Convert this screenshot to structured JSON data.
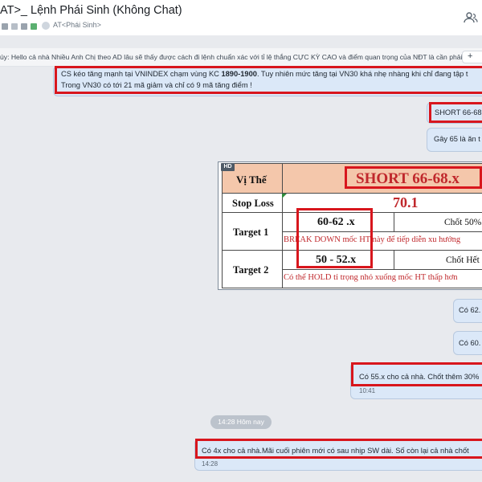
{
  "header": {
    "title": "AT>_ Lệnh Phái Sinh (Không Chat)",
    "subtitle": "AT<Phái Sinh>",
    "members_icon": "people-icon"
  },
  "pinned": {
    "text": "úy: Hello cả nhà Nhiều Anh Chị theo AD lâu sẽ thấy được cách đi lệnh chuẩn xác với tỉ lệ thắng CỰC KỲ CAO và điểm quan trọng của NĐT là cần phải ...",
    "button_label": "+"
  },
  "messages": {
    "m1": {
      "line1_pre": "CS kéo tăng mạnh tại VNINDEX chạm vùng KC ",
      "line1_bold": "1890-1900",
      "line1_post": ". Tuy nhiên mức tăng tại VN30 khá nhẹ nhàng khi chỉ đang tập t",
      "line2": "Trong VN30 có tới 21 mã giảm và chỉ có 9 mã tăng điểm !"
    },
    "m2": {
      "text": "SHORT 66-68."
    },
    "m3": {
      "text": "Gây 65 là ăn t"
    },
    "m5": {
      "text": "Có 62."
    },
    "m6": {
      "text": "Có 60."
    },
    "m7": {
      "text": "Có 55.x cho cả nhà. Chốt thêm 30%",
      "time": "10:41"
    },
    "divider": "14:28 Hôm nay",
    "m8": {
      "text": "Có 4x cho cả nhà.Mãi cuối phiên mới có sau nhịp SW dài. Số còn lại cả nhà chốt",
      "time": "14:28"
    }
  },
  "signal_image": {
    "badge": "HD",
    "vi_the_label": "Vị Thế",
    "position": "SHORT 66-68.x",
    "stop_loss_label": "Stop Loss",
    "stop_loss_value": "70.1",
    "target1_label": "Target 1",
    "target1_value": "60-62 .x",
    "target1_close": "Chốt 50%",
    "target1_note": "BREAK DOWN mốc HT này để tiếp diễn xu hướng",
    "target2_label": "Target 2",
    "target2_value": "50 - 52.x",
    "target2_close": "Chốt Hết",
    "target2_note": "Có thể HOLD tỉ trọng nhỏ xuống mốc HT thấp hơn"
  },
  "colors": {
    "bubble": "#dbe8f8",
    "highlight_box": "#d8161d",
    "table_header": "#f4c7ab",
    "stop_loss_red": "#c0282c"
  }
}
